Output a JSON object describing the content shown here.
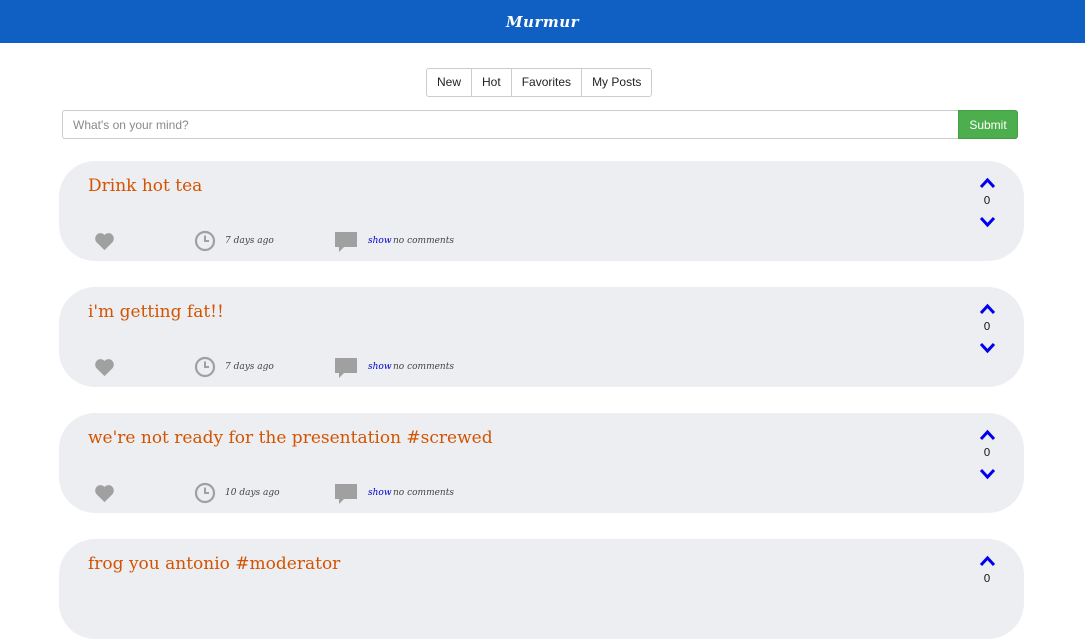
{
  "header": {
    "brand": "Murmur"
  },
  "tabs": [
    {
      "label": "New"
    },
    {
      "label": "Hot"
    },
    {
      "label": "Favorites"
    },
    {
      "label": "My Posts"
    }
  ],
  "composer": {
    "placeholder": "What's on your mind?",
    "submit_label": "Submit"
  },
  "posts": [
    {
      "text": "Drink hot tea",
      "time": "7 days ago",
      "show_label": "show",
      "comments": "no comments",
      "votes": "0"
    },
    {
      "text": "i'm getting fat!!",
      "time": "7 days ago",
      "show_label": "show",
      "comments": "no comments",
      "votes": "0"
    },
    {
      "text": "we're not ready for the presentation #screwed",
      "time": "10 days ago",
      "show_label": "show",
      "comments": "no comments",
      "votes": "0"
    },
    {
      "text": "frog you antonio #moderator",
      "time": "",
      "show_label": "",
      "comments": "",
      "votes": "0"
    }
  ],
  "colors": {
    "navbar": "#1060c4",
    "post_text": "#d35400",
    "submit": "#4cae4c",
    "vote_arrow": "#0000ee",
    "meta_icon": "#a0a0a0"
  },
  "icons": [
    "heart-icon",
    "clock-icon",
    "comment-icon",
    "chevron-up-icon",
    "chevron-down-icon"
  ]
}
